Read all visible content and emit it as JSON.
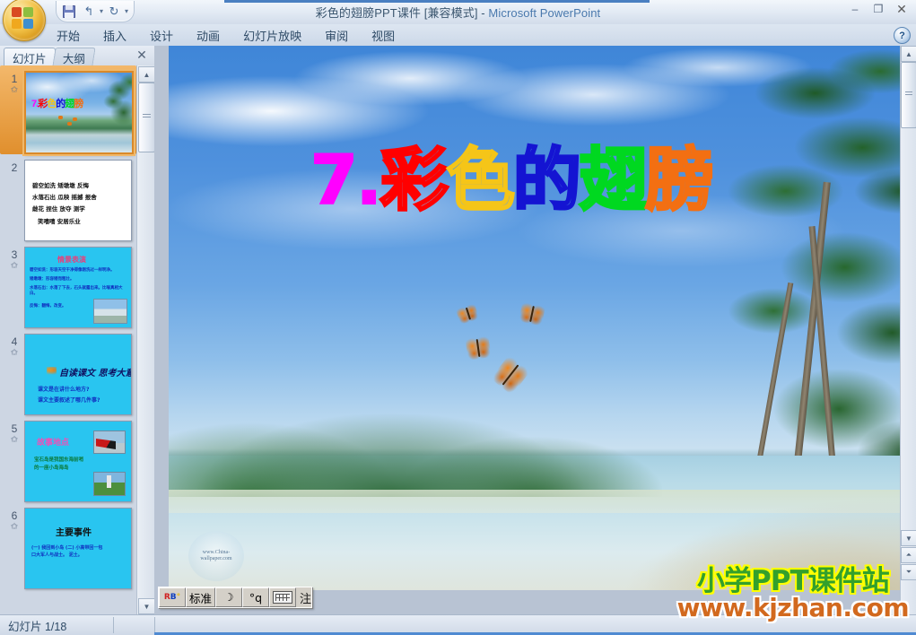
{
  "window": {
    "title": "彩色的翅膀PPT课件 [兼容模式]  -  Microsoft PowerPoint",
    "title_doc": "彩色的翅膀PPT课件 [兼容模式]",
    "title_sep": " - ",
    "title_app": "Microsoft PowerPoint",
    "minimize": "–",
    "restore": "❐",
    "close": "✕",
    "help": "?"
  },
  "quick_access": {
    "save_icon": "save-icon",
    "undo_icon": "↰",
    "undo_dropdown": "▾",
    "redo_icon": "↻",
    "customize": "▾"
  },
  "ribbon": {
    "tabs": [
      {
        "label": "开始"
      },
      {
        "label": "插入"
      },
      {
        "label": "设计"
      },
      {
        "label": "动画"
      },
      {
        "label": "幻灯片放映"
      },
      {
        "label": "审阅"
      },
      {
        "label": "视图"
      }
    ]
  },
  "panel": {
    "tabs": [
      {
        "label": "幻灯片",
        "active": true
      },
      {
        "label": "大纲",
        "active": false
      }
    ],
    "close": "✕",
    "scroll_up": "▲",
    "scroll_down": "▼",
    "thumbnails": [
      {
        "number": "1",
        "selected": true,
        "type": "title",
        "title": "7.彩色的翅膀"
      },
      {
        "number": "2",
        "selected": false,
        "type": "words",
        "lines": [
          "碧空如洗    矮墩墩    反悔",
          "水落石出    瓜秧    摇撼    报舍",
          "雌花    捏住    放夺    测学",
          "笑嘻嘻    安居乐业"
        ]
      },
      {
        "number": "3",
        "selected": false,
        "type": "cyan",
        "heading": "情景表演",
        "bullets": [
          "碧空如洗：形容天空干净得像刚洗过一样明净。",
          "矮墩墩：形容矮而粗壮。",
          "水落石出：水落了下去，石头就露出来。比喻真相大白。",
          "反悔：翻悔，改变。"
        ]
      },
      {
        "number": "4",
        "selected": false,
        "type": "cyan",
        "heading": "自读课文 思考大意",
        "bullets": [
          "课文是在讲什么地方?",
          "课文主要叙述了哪几件事?"
        ]
      },
      {
        "number": "5",
        "selected": false,
        "type": "cyan",
        "heading": "故事地点",
        "bullets": [
          "宝石岛是我国东海前哨",
          "的一座小岛海岛",
          ""
        ]
      },
      {
        "number": "6",
        "selected": false,
        "type": "cyan",
        "heading": "主要事件",
        "bullets": [
          "(一) 我回到小岛    (二) 小高带回一包",
          "口大军人与战士。  泥土。"
        ]
      }
    ]
  },
  "slide": {
    "title_chars": [
      {
        "text": "7.",
        "color": "#ff00ff"
      },
      {
        "text": "彩",
        "color": "#ff0000"
      },
      {
        "text": "色",
        "color": "#f5c518"
      },
      {
        "text": "的",
        "color": "#1414d2"
      },
      {
        "text": "翅",
        "color": "#00d820"
      },
      {
        "text": "膀",
        "color": "#f36f12"
      }
    ],
    "title_plain": "7.彩色的翅膀",
    "image_watermark": "www.China-wallpaper.com",
    "site_watermark_line1": "小学PPT课件站",
    "site_watermark_line2": "www.kjzhan.com",
    "butterfly_count": 4,
    "scroll_up": "▲",
    "scroll_down": "▼",
    "prev_slide": "⏶",
    "next_slide": "⏷"
  },
  "statusbar": {
    "slide_counter": "幻灯片 1/18"
  },
  "ime": {
    "logo": "ime-logo-icon",
    "mode_label": "标准",
    "moon_icon": "☽",
    "punct_icon": "°q",
    "keyboard_icon": "keyboard-icon",
    "trailing_text": "注"
  },
  "colors": {
    "accent_blue": "#4f8ad2",
    "selected_thumb": "#d9892a",
    "slide_cyan": "#29c5f0",
    "watermark_green": "#33a02c",
    "watermark_orange": "#d2691e"
  }
}
